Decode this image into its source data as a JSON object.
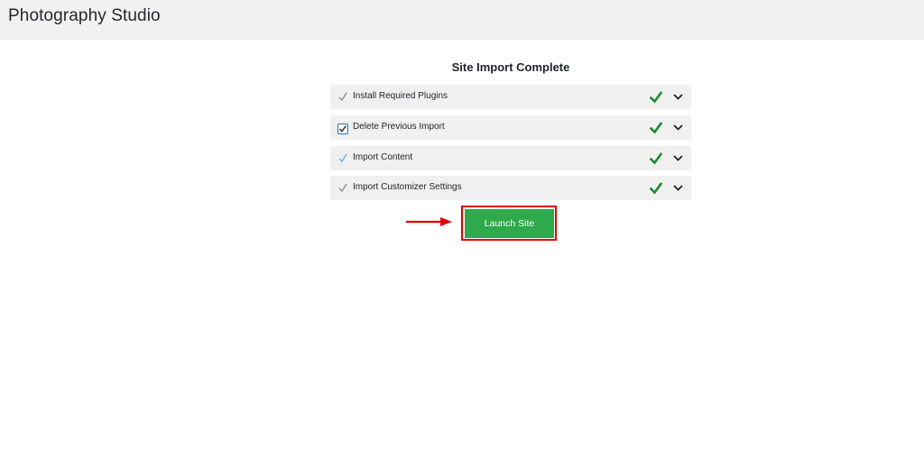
{
  "header": {
    "title": "Photography Studio"
  },
  "main": {
    "heading": "Site Import Complete",
    "steps": [
      {
        "label": "Install Required Plugins",
        "marker": "check-icon",
        "status": "complete"
      },
      {
        "label": "Delete Previous Import",
        "marker": "checkbox",
        "checked": true,
        "status": "complete"
      },
      {
        "label": "Import Content",
        "marker": "check-icon",
        "status": "complete"
      },
      {
        "label": "Import Customizer Settings",
        "marker": "check-icon",
        "status": "complete"
      }
    ],
    "launch_label": "Launch Site"
  },
  "colors": {
    "header_bg": "#f1f1f1",
    "step_bg": "#f0f0f1",
    "success_green": "#1e8c2e",
    "button_green": "#2ea94b",
    "highlight_red": "#e00000"
  },
  "icons": {
    "done": "checkmark-icon",
    "expand": "chevron-down-icon",
    "pointer": "arrow-right-icon"
  }
}
